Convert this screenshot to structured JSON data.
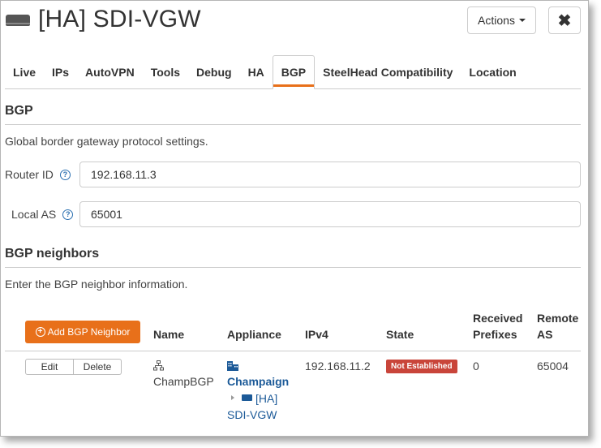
{
  "header": {
    "device_icon": "appliance-icon",
    "title": "[HA] SDI-VGW",
    "actions_label": "Actions",
    "close_label": "✖"
  },
  "tabs": [
    {
      "label": "Live",
      "active": false
    },
    {
      "label": "IPs",
      "active": false
    },
    {
      "label": "AutoVPN",
      "active": false
    },
    {
      "label": "Tools",
      "active": false
    },
    {
      "label": "Debug",
      "active": false
    },
    {
      "label": "HA",
      "active": false
    },
    {
      "label": "BGP",
      "active": true
    },
    {
      "label": "SteelHead Compatibility",
      "active": false
    },
    {
      "label": "Location",
      "active": false
    }
  ],
  "bgp": {
    "title": "BGP",
    "description": "Global border gateway protocol settings.",
    "router_id": {
      "label": "Router ID",
      "value": "192.168.11.3"
    },
    "local_as": {
      "label": "Local AS",
      "value": "65001"
    }
  },
  "neighbors": {
    "title": "BGP neighbors",
    "description": "Enter the BGP neighbor information.",
    "add_button": "Add BGP Neighbor",
    "columns": {
      "name": "Name",
      "appliance": "Appliance",
      "ipv4": "IPv4",
      "state": "State",
      "received_prefixes_1": "Received",
      "received_prefixes_2": "Prefixes",
      "remote_as_1": "Remote",
      "remote_as_2": "AS"
    },
    "rows": [
      {
        "edit_label": "Edit",
        "delete_label": "Delete",
        "name": "ChampBGP",
        "appliance_site": "Champaign",
        "appliance_line1": "[HA]",
        "appliance_line2": "SDI-VGW",
        "ipv4": "192.168.11.2",
        "state": "Not Established",
        "received_prefixes": "0",
        "remote_as": "65004"
      }
    ]
  },
  "colors": {
    "accent": "#e8701a",
    "link": "#1c5a98",
    "state_error": "#c9453a"
  }
}
